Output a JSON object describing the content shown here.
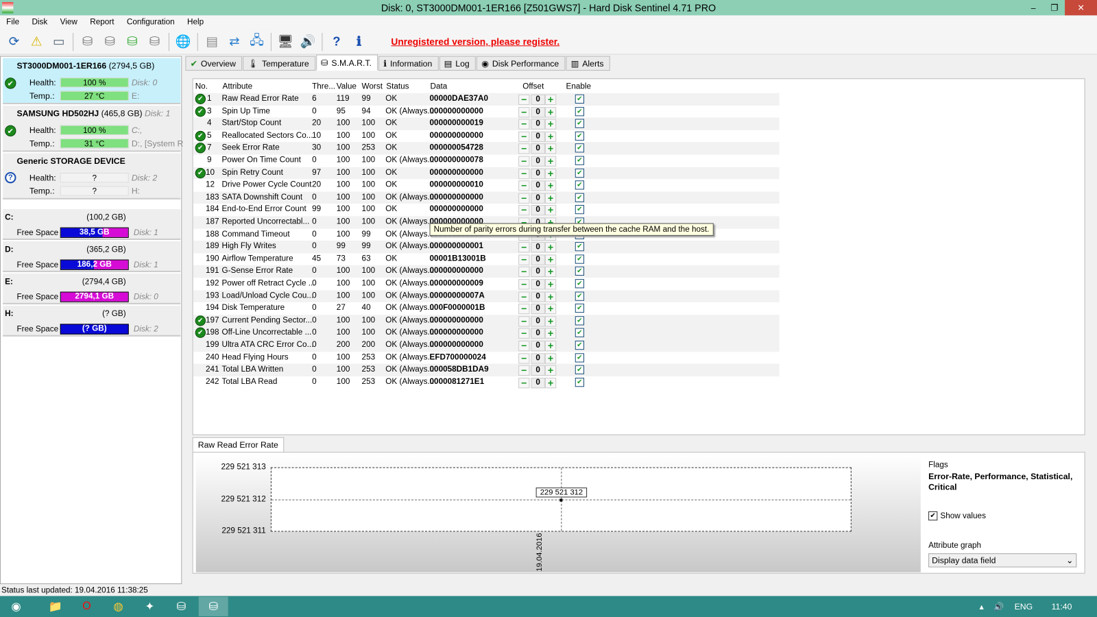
{
  "window": {
    "title": "Disk: 0, ST3000DM001-1ER166 [Z501GWS7]  -  Hard Disk Sentinel 4.71 PRO",
    "minimize": "–",
    "restore": "❐",
    "close": "✕"
  },
  "menu": [
    "File",
    "Disk",
    "View",
    "Report",
    "Configuration",
    "Help"
  ],
  "toolbar": {
    "register_text": "Unregistered version, please register.",
    "icons": [
      "refresh-icon",
      "alert-disk-icon",
      "disk-icon",
      "disk-surface-icon",
      "disk-timer-icon",
      "disk-check-icon",
      "disk-search-icon",
      "globe-disk-icon",
      "report-icon",
      "send-report-icon",
      "network-icon",
      "configuration-icon",
      "sound-icon",
      "help-icon",
      "info-icon"
    ]
  },
  "disks": [
    {
      "name": "ST3000DM001-1ER166",
      "size": "(2794,5 GB)",
      "health_label": "Health:",
      "health": "100 %",
      "health_pct": 100,
      "temp_label": "Temp.:",
      "temp": "27 °C",
      "disk": "Disk: 0",
      "drives": "E:",
      "status": "ok"
    },
    {
      "name": "SAMSUNG HD502HJ",
      "size": "(465,8 GB)",
      "disk_inline": "Disk: 1",
      "health_label": "Health:",
      "health": "100 %",
      "health_pct": 100,
      "temp_label": "Temp.:",
      "temp": "31 °C",
      "disk": "C:,",
      "drives": "D:,  [System R",
      "status": "ok"
    },
    {
      "name": "Generic STORAGE DEVICE",
      "size": "",
      "health_label": "Health:",
      "health": "?",
      "temp_label": "Temp.:",
      "temp": "?",
      "disk": "Disk: 2",
      "drives": "H:",
      "status": "unknown"
    }
  ],
  "volumes": [
    {
      "letter": "C:",
      "size": "(100,2 GB)",
      "label": "Free Space",
      "free": "38,5 GB",
      "free_pct": 38,
      "disk": "Disk: 1"
    },
    {
      "letter": "D:",
      "size": "(365,2 GB)",
      "label": "Free Space",
      "free": "186,2 GB",
      "free_pct": 51,
      "disk": "Disk: 1"
    },
    {
      "letter": "E:",
      "size": "(2794,4 GB)",
      "label": "Free Space",
      "free": "2794,1 GB",
      "free_pct": 100,
      "disk": "Disk: 0"
    },
    {
      "letter": "H:",
      "size": "(? GB)",
      "label": "Free Space",
      "free": "(? GB)",
      "free_pct": 0,
      "disk": "Disk: 2"
    }
  ],
  "tabs": [
    {
      "label": "Overview",
      "icon": "✔"
    },
    {
      "label": "Temperature",
      "icon": "🌡"
    },
    {
      "label": "S.M.A.R.T.",
      "icon": "⛁",
      "active": true
    },
    {
      "label": "Information",
      "icon": "ℹ"
    },
    {
      "label": "Log",
      "icon": "▤"
    },
    {
      "label": "Disk Performance",
      "icon": "◉"
    },
    {
      "label": "Alerts",
      "icon": "▥"
    }
  ],
  "smart": {
    "headers": {
      "no": "No.",
      "attribute": "Attribute",
      "threshold": "Thre...",
      "value": "Value",
      "worst": "Worst",
      "status": "Status",
      "data": "Data",
      "offset": "Offset",
      "enable": "Enable"
    },
    "rows": [
      {
        "ok": true,
        "no": "1",
        "attr": "Raw Read Error Rate",
        "thr": "6",
        "val": "119",
        "worst": "99",
        "status": "OK",
        "data": "00000DAE37A0",
        "offset": "0"
      },
      {
        "ok": true,
        "no": "3",
        "attr": "Spin Up Time",
        "thr": "0",
        "val": "95",
        "worst": "94",
        "status": "OK (Always...",
        "data": "000000000000",
        "offset": "0"
      },
      {
        "ok": false,
        "no": "4",
        "attr": "Start/Stop Count",
        "thr": "20",
        "val": "100",
        "worst": "100",
        "status": "OK",
        "data": "000000000019",
        "offset": "0"
      },
      {
        "ok": true,
        "no": "5",
        "attr": "Reallocated Sectors Co...",
        "thr": "10",
        "val": "100",
        "worst": "100",
        "status": "OK",
        "data": "000000000000",
        "offset": "0"
      },
      {
        "ok": true,
        "no": "7",
        "attr": "Seek Error Rate",
        "thr": "30",
        "val": "100",
        "worst": "253",
        "status": "OK",
        "data": "000000054728",
        "offset": "0"
      },
      {
        "ok": false,
        "no": "9",
        "attr": "Power On Time Count",
        "thr": "0",
        "val": "100",
        "worst": "100",
        "status": "OK (Always...",
        "data": "000000000078",
        "offset": "0"
      },
      {
        "ok": true,
        "no": "10",
        "attr": "Spin Retry Count",
        "thr": "97",
        "val": "100",
        "worst": "100",
        "status": "OK",
        "data": "000000000000",
        "offset": "0"
      },
      {
        "ok": false,
        "no": "12",
        "attr": "Drive Power Cycle Count",
        "thr": "20",
        "val": "100",
        "worst": "100",
        "status": "OK",
        "data": "000000000010",
        "offset": "0"
      },
      {
        "ok": false,
        "no": "183",
        "attr": "SATA Downshift Count",
        "thr": "0",
        "val": "100",
        "worst": "100",
        "status": "OK (Always...",
        "data": "000000000000",
        "offset": "0"
      },
      {
        "ok": false,
        "no": "184",
        "attr": "End-to-End Error Count",
        "thr": "99",
        "val": "100",
        "worst": "100",
        "status": "OK",
        "data": "000000000000",
        "offset": "0"
      },
      {
        "ok": false,
        "no": "187",
        "attr": "Reported Uncorrectabl...",
        "thr": "0",
        "val": "100",
        "worst": "100",
        "status": "OK (Always...",
        "data": "000000000000",
        "offset": "0"
      },
      {
        "ok": false,
        "no": "188",
        "attr": "Command Timeout",
        "thr": "0",
        "val": "100",
        "worst": "99",
        "status": "OK (Always...",
        "data": "000000000000",
        "offset": "0"
      },
      {
        "ok": false,
        "no": "189",
        "attr": "High Fly Writes",
        "thr": "0",
        "val": "99",
        "worst": "99",
        "status": "OK (Always...",
        "data": "000000000001",
        "offset": "0"
      },
      {
        "ok": false,
        "no": "190",
        "attr": "Airflow Temperature",
        "thr": "45",
        "val": "73",
        "worst": "63",
        "status": "OK",
        "data": "00001B13001B",
        "offset": "0"
      },
      {
        "ok": false,
        "no": "191",
        "attr": "G-Sense Error Rate",
        "thr": "0",
        "val": "100",
        "worst": "100",
        "status": "OK (Always...",
        "data": "000000000000",
        "offset": "0"
      },
      {
        "ok": false,
        "no": "192",
        "attr": "Power off Retract Cycle ...",
        "thr": "0",
        "val": "100",
        "worst": "100",
        "status": "OK (Always...",
        "data": "000000000009",
        "offset": "0"
      },
      {
        "ok": false,
        "no": "193",
        "attr": "Load/Unload Cycle Cou...",
        "thr": "0",
        "val": "100",
        "worst": "100",
        "status": "OK (Always...",
        "data": "00000000007A",
        "offset": "0"
      },
      {
        "ok": false,
        "no": "194",
        "attr": "Disk Temperature",
        "thr": "0",
        "val": "27",
        "worst": "40",
        "status": "OK (Always...",
        "data": "000F0000001B",
        "offset": "0"
      },
      {
        "ok": true,
        "no": "197",
        "attr": "Current Pending Sector...",
        "thr": "0",
        "val": "100",
        "worst": "100",
        "status": "OK (Always...",
        "data": "000000000000",
        "offset": "0"
      },
      {
        "ok": true,
        "no": "198",
        "attr": "Off-Line Uncorrectable ...",
        "thr": "0",
        "val": "100",
        "worst": "100",
        "status": "OK (Always...",
        "data": "000000000000",
        "offset": "0"
      },
      {
        "ok": false,
        "no": "199",
        "attr": "Ultra ATA CRC Error Co...",
        "thr": "0",
        "val": "200",
        "worst": "200",
        "status": "OK (Always...",
        "data": "000000000000",
        "offset": "0"
      },
      {
        "ok": false,
        "no": "240",
        "attr": "Head Flying Hours",
        "thr": "0",
        "val": "100",
        "worst": "253",
        "status": "OK (Always...",
        "data": "EFD700000024",
        "offset": "0"
      },
      {
        "ok": false,
        "no": "241",
        "attr": "Total LBA Written",
        "thr": "0",
        "val": "100",
        "worst": "253",
        "status": "OK (Always...",
        "data": "000058DB1DA9",
        "offset": "0"
      },
      {
        "ok": false,
        "no": "242",
        "attr": "Total LBA Read",
        "thr": "0",
        "val": "100",
        "worst": "253",
        "status": "OK (Always...",
        "data": "0000081271E1",
        "offset": "0"
      }
    ],
    "tooltip": "Number of parity errors during transfer between the cache RAM and the host."
  },
  "graph": {
    "tab": "Raw Read Error Rate",
    "y_ticks": [
      "229 521 313",
      "229 521 312",
      "229 521 311"
    ],
    "point_label": "229 521 312",
    "x_label": "19.04.2016",
    "flags_label": "Flags",
    "flags": "Error-Rate, Performance, Statistical, Critical",
    "show_values": "Show values",
    "attr_graph_label": "Attribute graph",
    "attr_graph_value": "Display data field"
  },
  "chart_data": {
    "type": "line",
    "x": [
      "19.04.2016"
    ],
    "values": [
      229521312
    ],
    "ylim": [
      229521311,
      229521313
    ],
    "grid": true
  },
  "status": "Status last updated: 19.04.2016 11:38:25",
  "taskbar": {
    "lang": "ENG",
    "time": "11:40"
  }
}
